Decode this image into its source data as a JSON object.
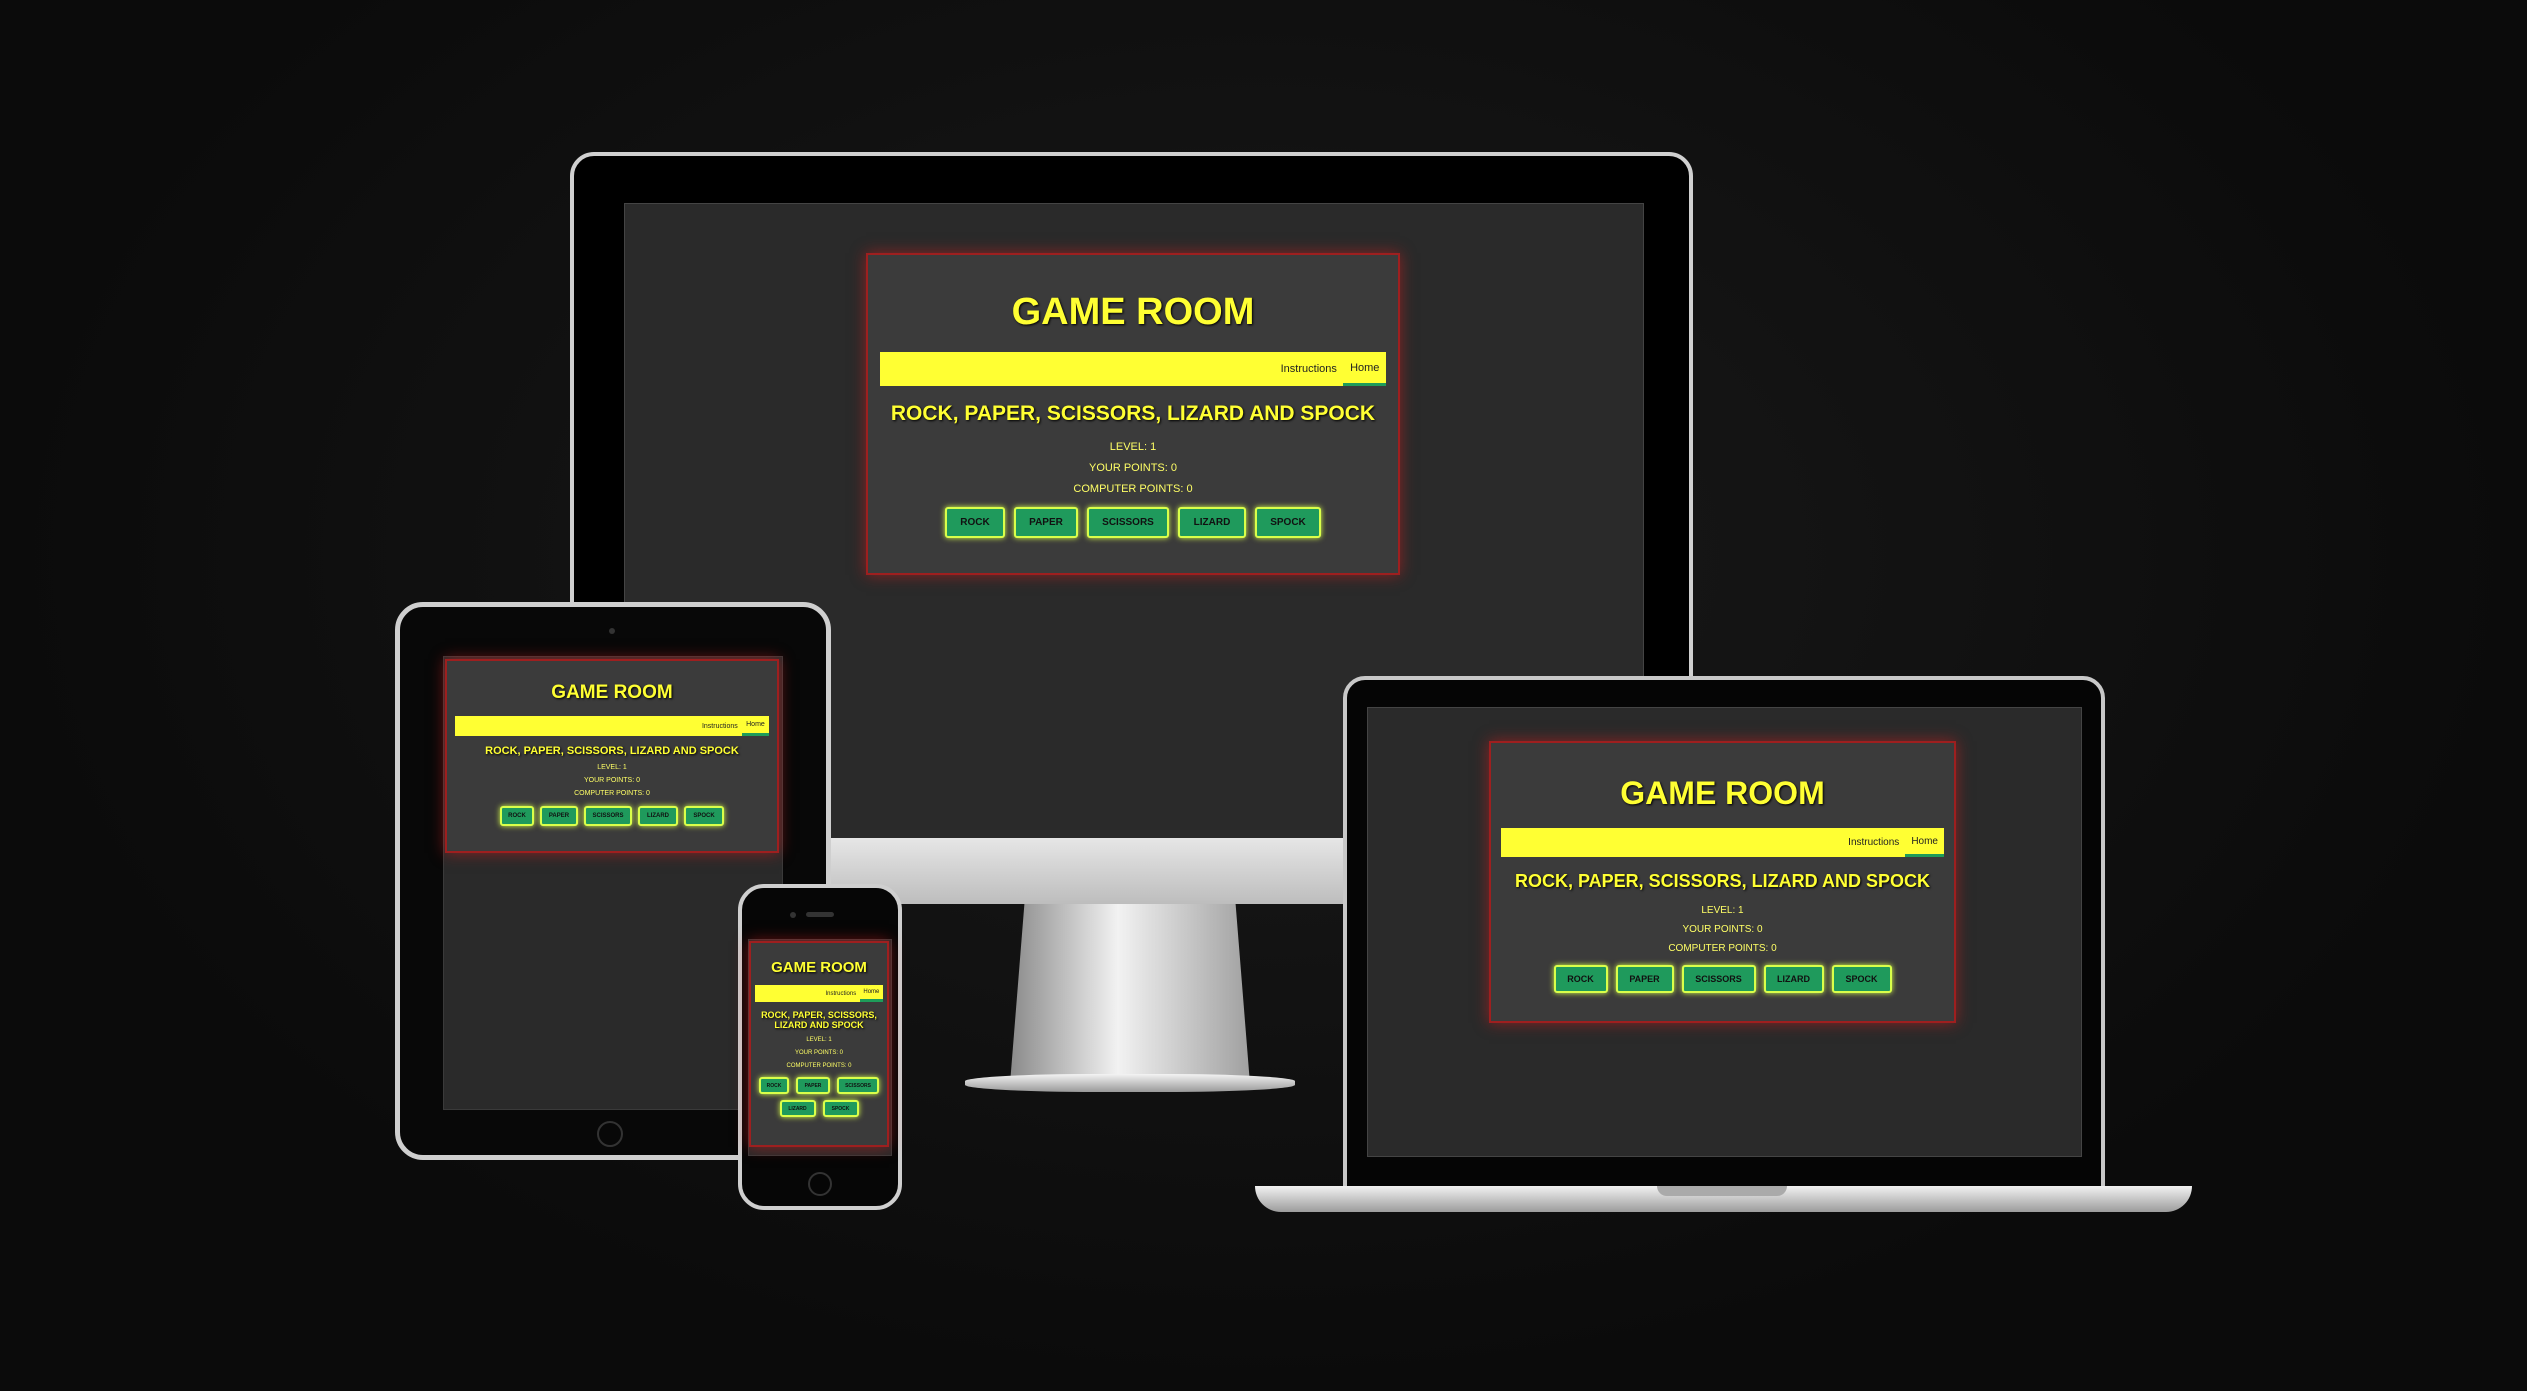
{
  "game": {
    "title": "GAME ROOM",
    "nav": {
      "instructions": "Instructions",
      "home": "Home"
    },
    "subtitle": "ROCK, PAPER, SCISSORS, LIZARD AND SPOCK",
    "level": "LEVEL: 1",
    "your_points": "YOUR POINTS: 0",
    "computer_points": "COMPUTER POINTS: 0",
    "buttons": {
      "rock": "ROCK",
      "paper": "PAPER",
      "scissors": "SCISSORS",
      "lizard": "LIZARD",
      "spock": "SPOCK"
    }
  },
  "colors": {
    "accent_yellow": "#ffff33",
    "button_green": "#1f9a5c",
    "card_border_red": "#9e1f1f",
    "background": "#0b0b0b"
  },
  "devices": [
    "desktop-monitor",
    "tablet",
    "laptop",
    "phone"
  ]
}
